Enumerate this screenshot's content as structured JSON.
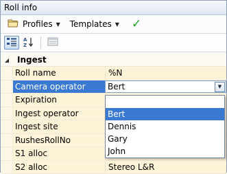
{
  "window": {
    "title": "Roll info"
  },
  "menubar": {
    "profiles_label": "Profiles",
    "templates_label": "Templates",
    "apply_icon": "checkmark-icon"
  },
  "toolbar": {
    "categorized_icon": "categorized-view-icon",
    "alphabetical_icon": "sort-alphabetical-icon",
    "property_pages_icon": "property-pages-icon"
  },
  "grid": {
    "category": "Ingest",
    "rows": [
      {
        "name": "Roll name",
        "value": "%N"
      },
      {
        "name": "Camera operator",
        "value": "Bert"
      },
      {
        "name": "Expiration",
        "value": ""
      },
      {
        "name": "Ingest operator",
        "value": ""
      },
      {
        "name": "Ingest site",
        "value": ""
      },
      {
        "name": "RushesRollNo",
        "value": ""
      },
      {
        "name": "S1 alloc",
        "value": ""
      },
      {
        "name": "S2 alloc",
        "value": "Stereo L&R"
      }
    ]
  },
  "dropdown": {
    "options": [
      "Bert",
      "Dennis",
      "Gary",
      "John"
    ],
    "highlighted": "Bert"
  },
  "colors": {
    "selection": "#3b7ad3",
    "row_background": "#fdf3d6",
    "apply_check": "#19a319"
  }
}
